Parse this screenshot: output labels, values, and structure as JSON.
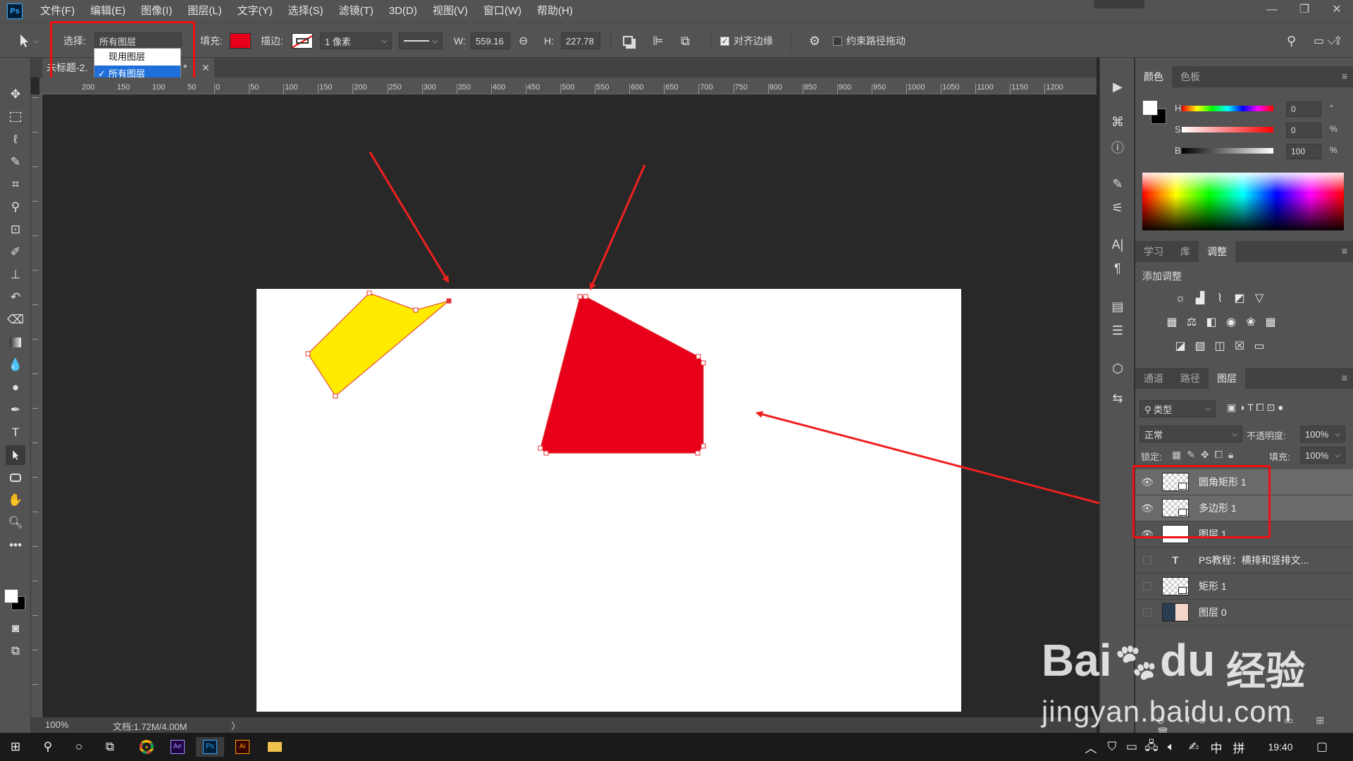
{
  "app": {
    "logo": "Ps"
  },
  "menu": [
    "文件(F)",
    "编辑(E)",
    "图像(I)",
    "图层(L)",
    "文字(Y)",
    "选择(S)",
    "滤镜(T)",
    "3D(D)",
    "视图(V)",
    "窗口(W)",
    "帮助(H)"
  ],
  "options": {
    "select_label": "选择:",
    "select_value": "所有图层",
    "fill_label": "填充:",
    "fill_color": "#e8001a",
    "stroke_label": "描边:",
    "stroke_width": "1 像素",
    "w_label": "W:",
    "w_value": "559.16",
    "h_label": "H:",
    "h_value": "227.78",
    "align_edges": "对齐边缘",
    "constrain_path": "约束路径拖动"
  },
  "dropdown": {
    "items": [
      "现用图层",
      "所有图层"
    ],
    "selected_index": 1
  },
  "document": {
    "tab_title": "未标题-2.",
    "tab_suffix": "*",
    "zoom": "100%",
    "doc_info": "文档:1.72M/4.00M"
  },
  "ruler": {
    "h_left": [
      "200",
      "150",
      "100",
      "50"
    ],
    "h_right": [
      "0",
      "50",
      "100",
      "150",
      "200",
      "250",
      "300",
      "350",
      "400",
      "450",
      "500",
      "550",
      "600",
      "650",
      "700",
      "750",
      "800",
      "850",
      "900",
      "950",
      "1000",
      "1050",
      "1100",
      "1150",
      "1200"
    ]
  },
  "shapes": {
    "polygon_color": "#ffeb00",
    "rect_color": "#e8001a",
    "arrow_color": "#f02020"
  },
  "color_panel": {
    "tabs": [
      "颜色",
      "色板"
    ],
    "h_label": "H",
    "h_value": "0",
    "h_unit": "°",
    "s_label": "S",
    "s_value": "0",
    "s_unit": "%",
    "b_label": "B",
    "b_value": "100",
    "b_unit": "%"
  },
  "adjust_panel": {
    "tabs": [
      "学习",
      "库",
      "调整"
    ],
    "title": "添加调整"
  },
  "layers_panel": {
    "tabs": [
      "通道",
      "路径",
      "图层"
    ],
    "filter_label": "类型",
    "blend_mode": "正常",
    "opacity_label": "不透明度:",
    "opacity_value": "100%",
    "lock_label": "锁定:",
    "fill_label": "填充:",
    "fill_value": "100%",
    "layers": [
      {
        "name": "圆角矩形 1",
        "visible": true,
        "selected": true,
        "kind": "shape"
      },
      {
        "name": "多边形 1",
        "visible": true,
        "selected": true,
        "kind": "shape"
      },
      {
        "name": "图层 1",
        "visible": true,
        "selected": false,
        "kind": "white"
      },
      {
        "name": "PS教程：横排和竖排文...",
        "visible": false,
        "selected": false,
        "kind": "text"
      },
      {
        "name": "矩形 1",
        "visible": false,
        "selected": false,
        "kind": "shape"
      },
      {
        "name": "图层 0",
        "visible": false,
        "selected": false,
        "kind": "photo"
      }
    ]
  },
  "taskbar": {
    "ime": "中",
    "ime2": "拼",
    "time": "19:40"
  },
  "watermark": {
    "line1": "Bai",
    "line2": "du",
    "line3": "经验",
    "url": "jingyan.baidu.com"
  }
}
